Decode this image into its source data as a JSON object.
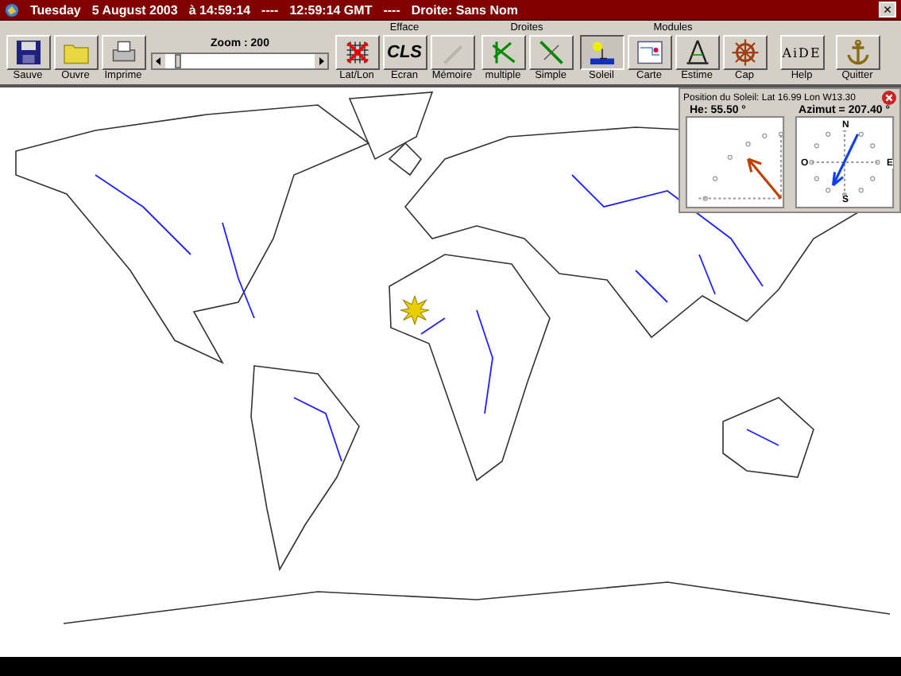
{
  "title_bar": {
    "texts": [
      "Tuesday",
      "5  August  2003",
      "à 14:59:14",
      "----",
      "12:59:14  GMT",
      "----",
      "Droite: Sans Nom"
    ],
    "close": "×"
  },
  "toolbar": {
    "file_buttons": [
      {
        "kind": "save",
        "label": "Sauve"
      },
      {
        "kind": "open",
        "label": "Ouvre"
      },
      {
        "kind": "print",
        "label": "Imprime"
      }
    ],
    "zoom": {
      "label": "Zoom : 200",
      "level": 0.08
    },
    "efface": {
      "label": "Efface",
      "buttons": [
        {
          "kind": "grid",
          "label": "Lat/Lon"
        },
        {
          "kind": "cls",
          "label": "Ecran",
          "icon_text": "CLS"
        },
        {
          "kind": "pen",
          "label": "Mémoire",
          "disabled": true
        }
      ]
    },
    "droites": {
      "label": "Droites",
      "buttons": [
        {
          "kind": "multi",
          "label": "multiple"
        },
        {
          "kind": "line",
          "label": "Simple"
        }
      ]
    },
    "modules": {
      "label": "Modules",
      "buttons": [
        {
          "kind": "sun",
          "label": "Soleil",
          "selected": true
        },
        {
          "kind": "chart",
          "label": "Carte",
          "selected": false
        },
        {
          "kind": "compass",
          "label": "Estime",
          "selected": false
        },
        {
          "kind": "wheel",
          "label": "Cap",
          "selected": false
        }
      ]
    },
    "end_buttons": [
      {
        "kind": "help",
        "label": "Help",
        "icon_text": "AiDE"
      },
      {
        "kind": "anchor",
        "label": "Quitter"
      }
    ]
  },
  "sun_panel": {
    "title": "Position du Soleil: Lat 16.99 Lon W13.30",
    "height": "He: 55.50 °",
    "azimuth": "Azimut = 207.40 °",
    "compass": {
      "n": "N",
      "e": "E",
      "s": "S",
      "w": "O"
    }
  }
}
